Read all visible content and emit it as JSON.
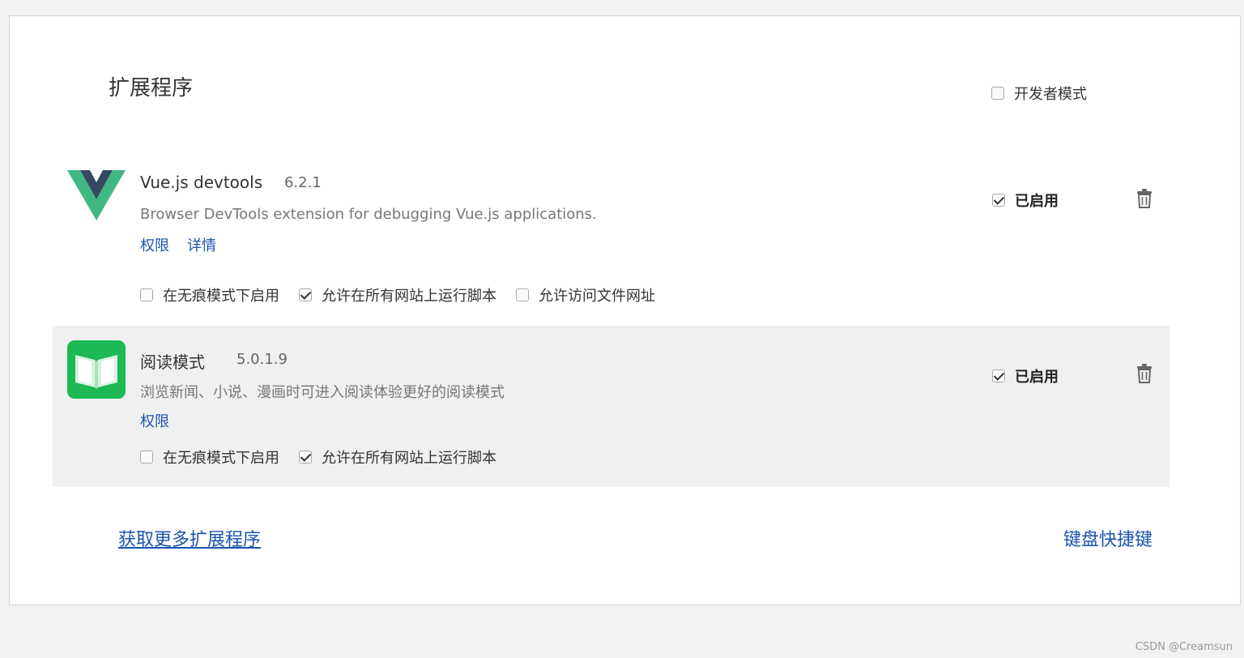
{
  "page": {
    "title": "扩展程序",
    "developer_mode_label": "开发者模式",
    "developer_mode_checked": false
  },
  "extensions": [
    {
      "name": "Vue.js devtools",
      "version": "6.2.1",
      "description": "Browser DevTools extension for debugging Vue.js applications.",
      "links": [
        "权限",
        "详情"
      ],
      "enabled_label": "已启用",
      "enabled": true,
      "options": [
        {
          "label": "在无痕模式下启用",
          "checked": false
        },
        {
          "label": "允许在所有网站上运行脚本",
          "checked": true
        },
        {
          "label": "允许访问文件网址",
          "checked": false
        }
      ],
      "icon": "vue-logo-icon"
    },
    {
      "name": "阅读模式",
      "version": "5.0.1.9",
      "description": "浏览新闻、小说、漫画时可进入阅读体验更好的阅读模式",
      "links": [
        "权限"
      ],
      "enabled_label": "已启用",
      "enabled": true,
      "options": [
        {
          "label": "在无痕模式下启用",
          "checked": false
        },
        {
          "label": "允许在所有网站上运行脚本",
          "checked": true
        }
      ],
      "icon": "book-icon"
    }
  ],
  "footer": {
    "get_more_label": "获取更多扩展程序",
    "shortcuts_label": "键盘快捷键"
  },
  "watermark": "CSDN @Creamsun",
  "colors": {
    "link": "#1c54b0",
    "vue_green": "#41b883",
    "vue_dark": "#35495e",
    "reader_green": "#1db954"
  }
}
